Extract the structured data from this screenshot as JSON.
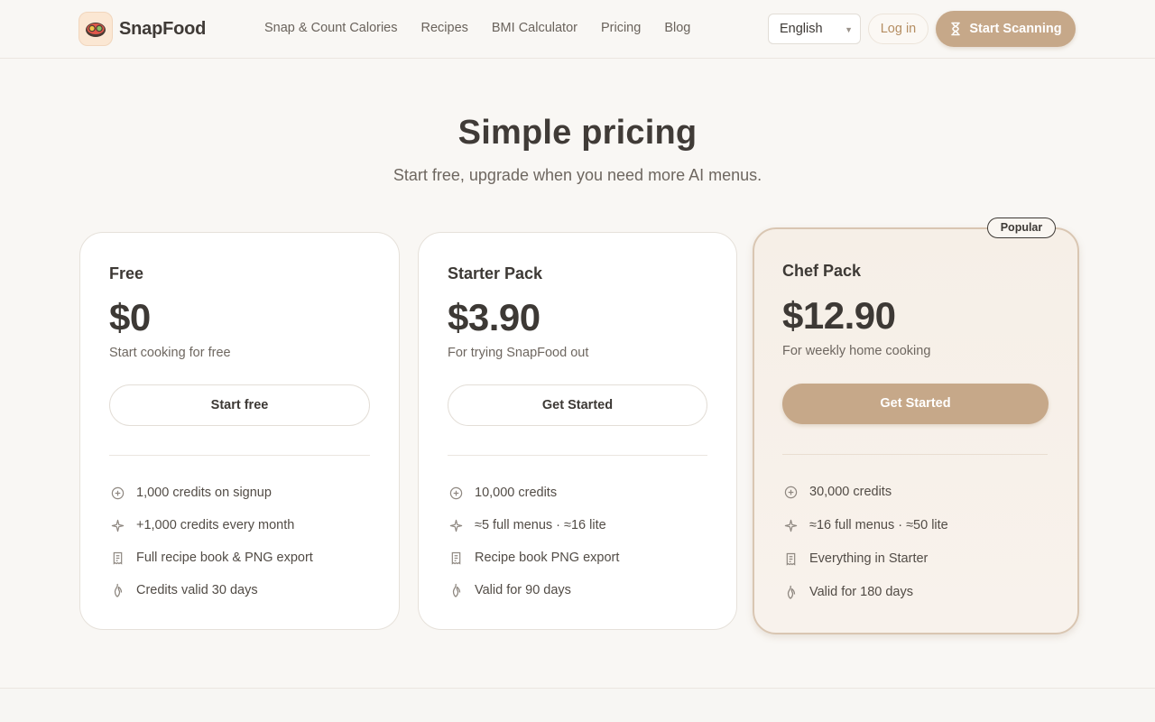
{
  "brand": {
    "name": "SnapFood",
    "logo_icon": "food-bowl-icon"
  },
  "nav": {
    "items": [
      {
        "label": "Snap & Count Calories"
      },
      {
        "label": "Recipes"
      },
      {
        "label": "BMI Calculator"
      },
      {
        "label": "Pricing"
      },
      {
        "label": "Blog"
      }
    ]
  },
  "header": {
    "language": "English",
    "login_label": "Log in",
    "scan_label": "Start Scanning",
    "scan_icon": "hourglass-icon"
  },
  "hero": {
    "title": "Simple pricing",
    "subtitle": "Start free, upgrade when you need more AI menus."
  },
  "plans": [
    {
      "name": "Free",
      "price": "$0",
      "desc": "Start cooking for free",
      "cta": "Start free",
      "features": [
        {
          "icon": "plus-circle-icon",
          "text": "1,000 credits on signup"
        },
        {
          "icon": "sparkle-icon",
          "text": "+1,000 credits every month"
        },
        {
          "icon": "receipt-icon",
          "text": "Full recipe book & PNG export"
        },
        {
          "icon": "flame-icon",
          "text": "Credits valid 30 days"
        }
      ]
    },
    {
      "name": "Starter Pack",
      "price": "$3.90",
      "desc": "For trying SnapFood out",
      "cta": "Get Started",
      "features": [
        {
          "icon": "plus-circle-icon",
          "text": "10,000 credits"
        },
        {
          "icon": "sparkle-icon",
          "text": "≈5 full menus · ≈16 lite"
        },
        {
          "icon": "receipt-icon",
          "text": "Recipe book PNG export"
        },
        {
          "icon": "flame-icon",
          "text": "Valid for 90 days"
        }
      ]
    },
    {
      "name": "Chef Pack",
      "price": "$12.90",
      "desc": "For weekly home cooking",
      "cta": "Get Started",
      "badge": "Popular",
      "features": [
        {
          "icon": "plus-circle-icon",
          "text": "30,000 credits"
        },
        {
          "icon": "sparkle-icon",
          "text": "≈16 full menus · ≈50 lite"
        },
        {
          "icon": "receipt-icon",
          "text": "Everything in Starter"
        },
        {
          "icon": "flame-icon",
          "text": "Valid for 180 days"
        }
      ]
    }
  ],
  "colors": {
    "accent": "#c6a889",
    "background": "#f9f7f4",
    "text": "#3d3935"
  }
}
